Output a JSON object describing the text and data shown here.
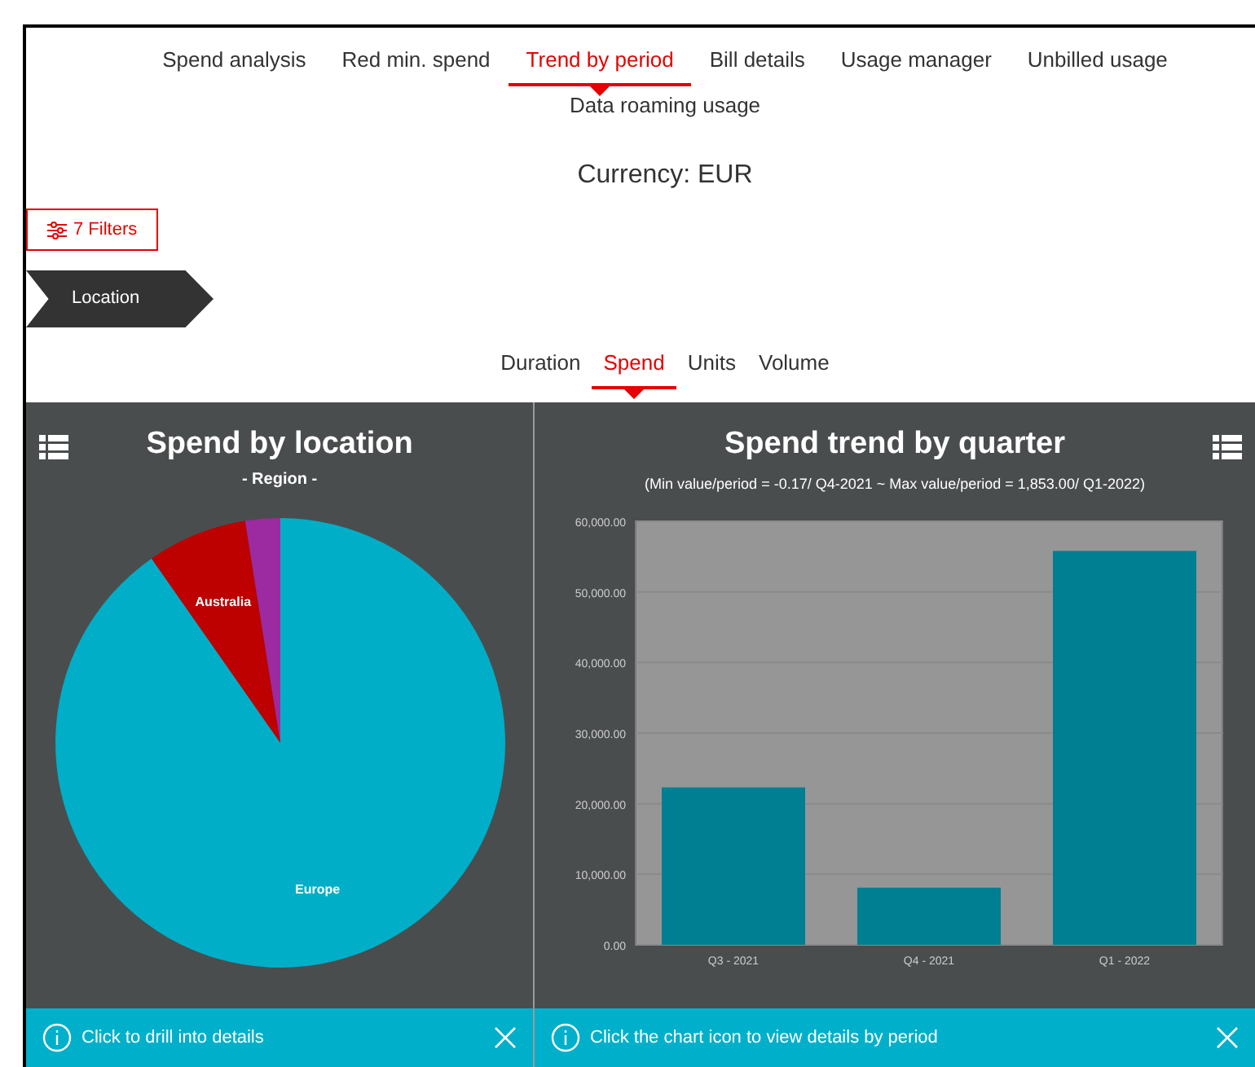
{
  "tabs": [
    {
      "label": "Spend analysis",
      "selected": false
    },
    {
      "label": "Red min. spend",
      "selected": false
    },
    {
      "label": "Trend by period",
      "selected": true
    },
    {
      "label": "Bill details",
      "selected": false
    },
    {
      "label": "Usage manager",
      "selected": false
    },
    {
      "label": "Unbilled usage",
      "selected": false
    },
    {
      "label": "Data roaming usage",
      "selected": false
    }
  ],
  "currency": "Currency: EUR",
  "filters_button": "7 Filters",
  "breadcrumb": "Location",
  "metric_tabs": [
    {
      "label": "Duration",
      "selected": false
    },
    {
      "label": "Spend",
      "selected": true
    },
    {
      "label": "Units",
      "selected": false
    },
    {
      "label": "Volume",
      "selected": false
    }
  ],
  "left_panel": {
    "title": "Spend by location",
    "subtitle": "- Region -",
    "chart_data": {
      "type": "pie",
      "categories": [
        "Europe",
        "Australia",
        null
      ],
      "values": [
        0.903,
        0.072,
        0.025
      ],
      "colors": [
        "#00aec7",
        "#bd0000",
        "#9c2aa0"
      ]
    },
    "hint": "Click to drill into details"
  },
  "right_panel": {
    "title": "Spend trend by quarter",
    "subtitle": "(Min value/period = -0.17/ Q4-2021 ~ Max value/period = 1,853.00/ Q1-2022)",
    "chart_data": {
      "type": "bar",
      "categories": [
        "Q3 - 2021",
        "Q4 - 2021",
        "Q1 - 2022"
      ],
      "values": [
        22300,
        8100,
        55800
      ],
      "color": "#007e92",
      "ylim": [
        0,
        60000
      ],
      "grid": true,
      "yticks": [
        {
          "value": 0,
          "label": "0.00"
        },
        {
          "value": 10000,
          "label": "10,000.00"
        },
        {
          "value": 20000,
          "label": "20,000.00"
        },
        {
          "value": 30000,
          "label": "30,000.00"
        },
        {
          "value": 40000,
          "label": "40,000.00"
        },
        {
          "value": 50000,
          "label": "50,000.00"
        },
        {
          "value": 60000,
          "label": "60,000.00"
        }
      ]
    },
    "hint": "Click the chart icon to view details by period"
  }
}
